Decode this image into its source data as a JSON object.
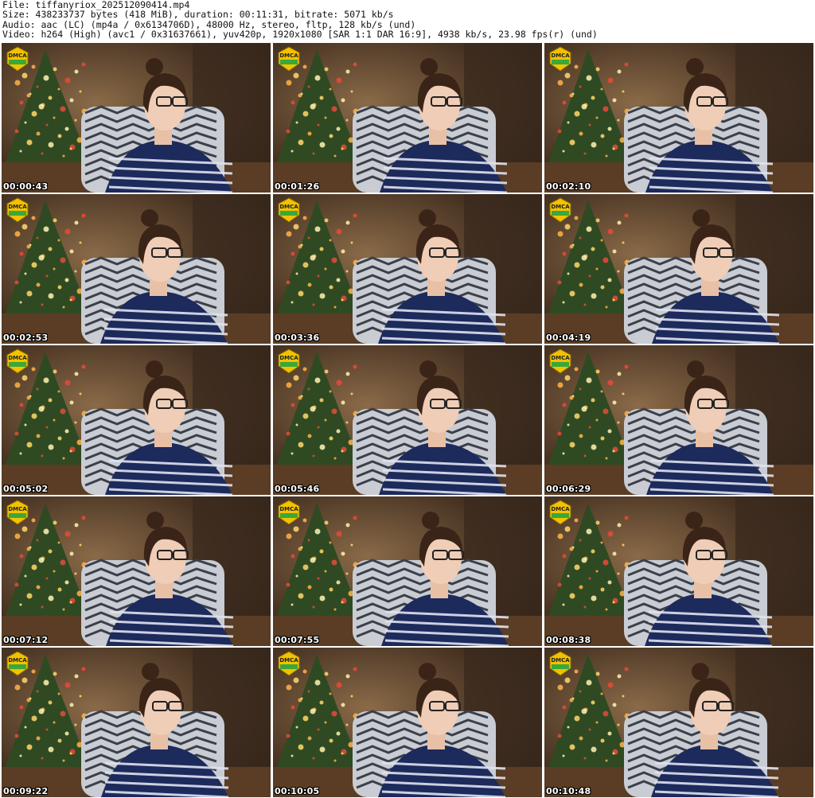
{
  "header": {
    "file_line": "File: tiffanyriox_202512090414.mp4",
    "size_line": "Size: 438233737 bytes (418 MiB), duration: 00:11:31, bitrate: 5071 kb/s",
    "audio_line": "Audio: aac (LC) (mp4a / 0x6134706D), 48000 Hz, stereo, fltp, 128 kb/s (und)",
    "video_line": "Video: h264 (High) (avc1 / 0x31637661), yuv420p, 1920x1080 [SAR 1:1 DAR 16:9], 4938 kb/s, 23.98 fps(r) (und)"
  },
  "badge_text": "DMCA",
  "thumbnails": [
    {
      "timestamp": "00:00:43"
    },
    {
      "timestamp": "00:01:26"
    },
    {
      "timestamp": "00:02:10"
    },
    {
      "timestamp": "00:02:53"
    },
    {
      "timestamp": "00:03:36"
    },
    {
      "timestamp": "00:04:19"
    },
    {
      "timestamp": "00:05:02"
    },
    {
      "timestamp": "00:05:46"
    },
    {
      "timestamp": "00:06:29"
    },
    {
      "timestamp": "00:07:12"
    },
    {
      "timestamp": "00:07:55"
    },
    {
      "timestamp": "00:08:38"
    },
    {
      "timestamp": "00:09:22"
    },
    {
      "timestamp": "00:10:05"
    },
    {
      "timestamp": "00:10:48"
    }
  ]
}
